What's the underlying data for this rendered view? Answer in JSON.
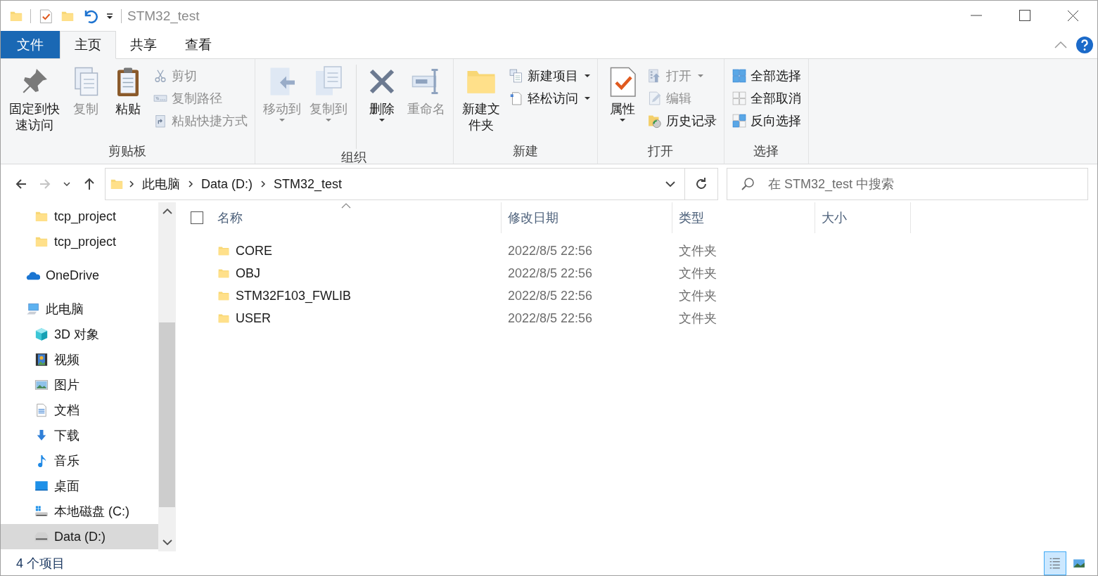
{
  "title_bar": {
    "title": "STM32_test"
  },
  "ribbon_tabs": [
    {
      "label": "文件",
      "kind": "file",
      "selected": false
    },
    {
      "label": "主页",
      "kind": "tab",
      "selected": true
    },
    {
      "label": "共享",
      "kind": "tab",
      "selected": false
    },
    {
      "label": "查看",
      "kind": "tab",
      "selected": false
    }
  ],
  "ribbon_groups": [
    {
      "title": "剪贴板",
      "items": [
        {
          "kind": "large",
          "label": "固定到快速访问",
          "disabled": false,
          "dropdown": false
        },
        {
          "kind": "large",
          "label": "复制",
          "disabled": true,
          "dropdown": false
        },
        {
          "kind": "large",
          "label": "粘贴",
          "disabled": false,
          "dropdown": false
        },
        {
          "kind": "stack",
          "buttons": [
            {
              "label": "剪切",
              "disabled": true,
              "dropdown": false
            },
            {
              "label": "复制路径",
              "disabled": true,
              "dropdown": false
            },
            {
              "label": "粘贴快捷方式",
              "disabled": true,
              "dropdown": false
            }
          ]
        }
      ]
    },
    {
      "title": "组织",
      "items": [
        {
          "kind": "large",
          "label": "移动到",
          "disabled": true,
          "dropdown": true
        },
        {
          "kind": "large",
          "label": "复制到",
          "disabled": true,
          "dropdown": true
        },
        {
          "kind": "separator"
        },
        {
          "kind": "large",
          "label": "删除",
          "disabled": false,
          "dropdown": true
        },
        {
          "kind": "large",
          "label": "重命名",
          "disabled": true,
          "dropdown": false
        }
      ]
    },
    {
      "title": "新建",
      "items": [
        {
          "kind": "large",
          "label": "新建文件夹",
          "disabled": false,
          "dropdown": false
        },
        {
          "kind": "stack",
          "buttons": [
            {
              "label": "新建项目",
              "disabled": false,
              "dropdown": true
            },
            {
              "label": "轻松访问",
              "disabled": false,
              "dropdown": true
            }
          ]
        }
      ]
    },
    {
      "title": "打开",
      "items": [
        {
          "kind": "large",
          "label": "属性",
          "disabled": false,
          "dropdown": true
        },
        {
          "kind": "stack",
          "buttons": [
            {
              "label": "打开",
              "disabled": true,
              "dropdown": true
            },
            {
              "label": "编辑",
              "disabled": true,
              "dropdown": false
            },
            {
              "label": "历史记录",
              "disabled": false,
              "dropdown": false
            }
          ]
        }
      ]
    },
    {
      "title": "选择",
      "items": [
        {
          "kind": "stack",
          "buttons": [
            {
              "label": "全部选择",
              "disabled": false,
              "dropdown": false
            },
            {
              "label": "全部取消",
              "disabled": false,
              "dropdown": false
            },
            {
              "label": "反向选择",
              "disabled": false,
              "dropdown": false
            }
          ]
        }
      ]
    }
  ],
  "nav_buttons": [
    {
      "kind": "back",
      "disabled": false
    },
    {
      "kind": "forward",
      "disabled": true
    },
    {
      "kind": "recent",
      "disabled": false
    },
    {
      "kind": "up",
      "disabled": false
    }
  ],
  "address": {
    "crumbs": [
      "此电脑",
      "Data (D:)",
      "STM32_test"
    ]
  },
  "search": {
    "placeholder": "在 STM32_test 中搜索"
  },
  "navigation": {
    "pinned": [
      {
        "label": "tcp_project",
        "selected": false
      },
      {
        "label": "tcp_project",
        "selected": false
      }
    ],
    "locations": [
      {
        "label": "OneDrive",
        "selected": false
      },
      {
        "label": "此电脑",
        "selected": false,
        "children": [
          {
            "label": "3D 对象",
            "selected": false
          },
          {
            "label": "视频",
            "selected": false
          },
          {
            "label": "图片",
            "selected": false
          },
          {
            "label": "文档",
            "selected": false
          },
          {
            "label": "下载",
            "selected": false
          },
          {
            "label": "音乐",
            "selected": false
          },
          {
            "label": "桌面",
            "selected": false
          },
          {
            "label": "本地磁盘 (C:)",
            "selected": false
          },
          {
            "label": "Data (D:)",
            "selected": true
          }
        ]
      }
    ]
  },
  "file_list": {
    "select_all_checked": false,
    "columns": [
      {
        "label": "名称",
        "sorted": true
      },
      {
        "label": "修改日期",
        "sorted": false
      },
      {
        "label": "类型",
        "sorted": false
      },
      {
        "label": "大小",
        "sorted": false
      }
    ],
    "rows": [
      {
        "name": "CORE",
        "modified": "2022/8/5 22:56",
        "type": "文件夹",
        "selected": false
      },
      {
        "name": "OBJ",
        "modified": "2022/8/5 22:56",
        "type": "文件夹",
        "selected": false
      },
      {
        "name": "STM32F103_FWLIB",
        "modified": "2022/8/5 22:56",
        "type": "文件夹",
        "selected": false
      },
      {
        "name": "USER",
        "modified": "2022/8/5 22:56",
        "type": "文件夹",
        "selected": false
      }
    ]
  },
  "status_bar": {
    "item_count": "4 个项目",
    "views": [
      {
        "kind": "details",
        "selected": true
      },
      {
        "kind": "large_icons",
        "selected": false
      }
    ]
  }
}
